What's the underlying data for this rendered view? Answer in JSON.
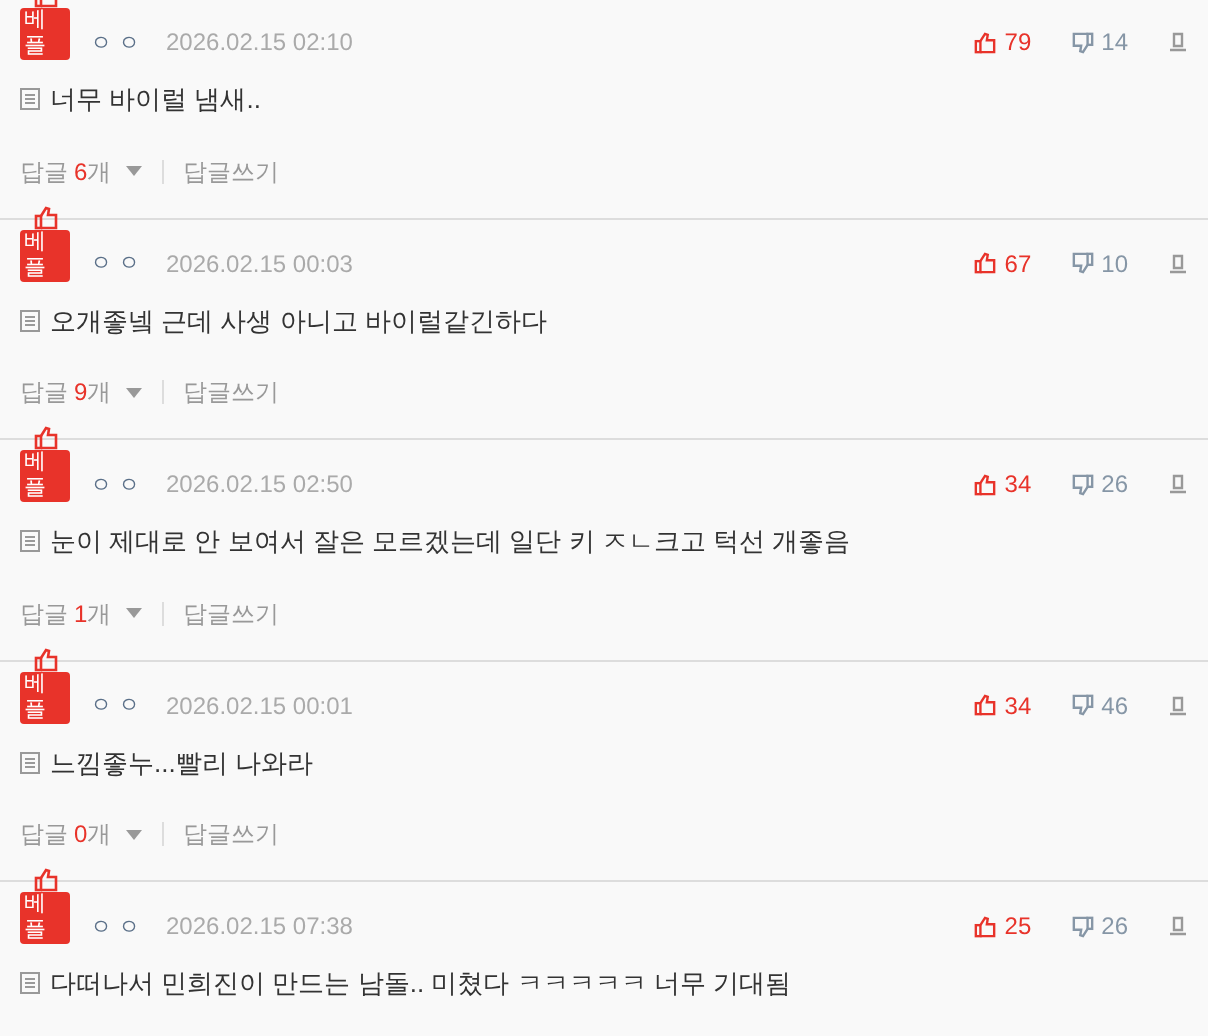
{
  "comments": [
    {
      "badge": "베플",
      "author": "ㅇㅇ",
      "date": "2026.02.15 02:10",
      "likes": "79",
      "dislikes": "14",
      "text": "너무 바이럴 냄새..",
      "reply": {
        "label": "답글",
        "count": "6",
        "unit": "개",
        "write": "답글쓰기"
      }
    },
    {
      "badge": "베플",
      "author": "ㅇㅇ",
      "date": "2026.02.15 00:03",
      "likes": "67",
      "dislikes": "10",
      "text": "오개좋넼 근데 사생 아니고 바이럴같긴하다",
      "reply": {
        "label": "답글",
        "count": "9",
        "unit": "개",
        "write": "답글쓰기"
      }
    },
    {
      "badge": "베플",
      "author": "ㅇㅇ",
      "date": "2026.02.15 02:50",
      "likes": "34",
      "dislikes": "26",
      "text": "눈이 제대로 안 보여서 잘은 모르겠는데 일단 키 ㅈㄴ크고 턱선 개좋음",
      "reply": {
        "label": "답글",
        "count": "1",
        "unit": "개",
        "write": "답글쓰기"
      }
    },
    {
      "badge": "베플",
      "author": "ㅇㅇ",
      "date": "2026.02.15 00:01",
      "likes": "34",
      "dislikes": "46",
      "text": "느낌좋누...빨리 나와라",
      "reply": {
        "label": "답글",
        "count": "0",
        "unit": "개",
        "write": "답글쓰기"
      }
    },
    {
      "badge": "베플",
      "author": "ㅇㅇ",
      "date": "2026.02.15 07:38",
      "likes": "25",
      "dislikes": "26",
      "text": "다떠나서 민희진이 만드는 남돌.. 미쳤다 ㅋㅋㅋㅋㅋ 너무 기대됨"
    }
  ]
}
